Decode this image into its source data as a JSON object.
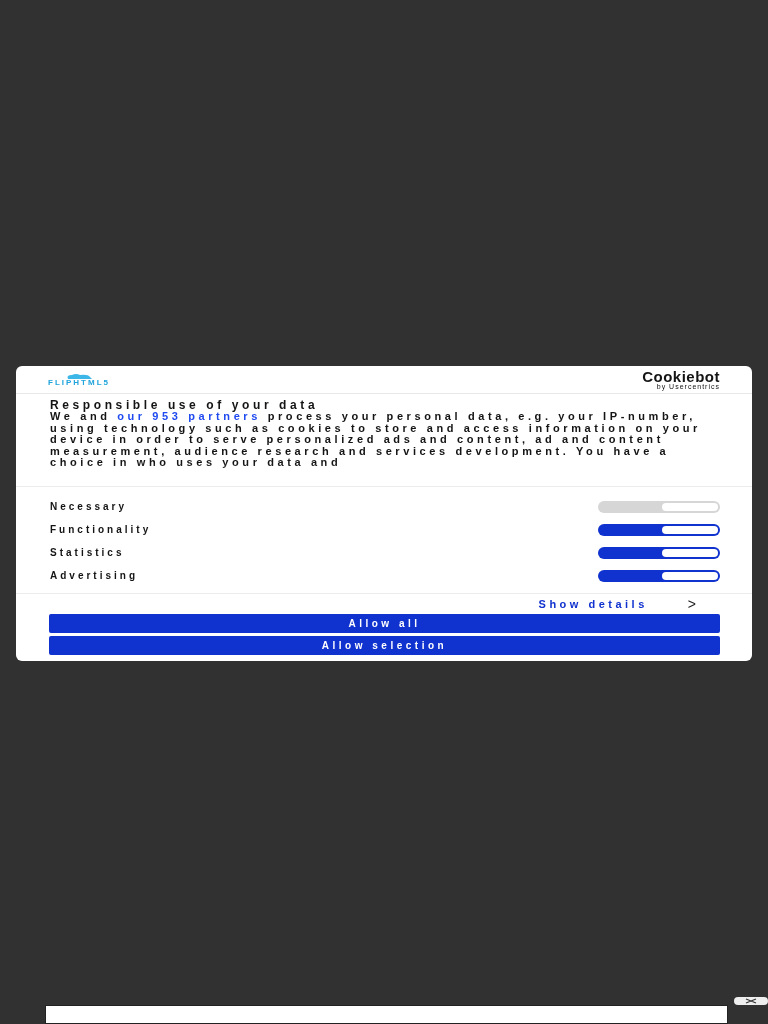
{
  "header": {
    "brand": "FLIPHTML5",
    "provider": "Cookiebot",
    "provider_sub": "by Usercentrics"
  },
  "consent": {
    "title": "Responsible use of your data",
    "text_before": "We and",
    "link": "our 953 partners",
    "text_after": "process your personal data, e.g. your IP-number, using technology such as cookies to store and access information on your device in order to serve personalized ads and content, ad and content measurement, audience research and services development. You have a choice in who uses your data and"
  },
  "categories": [
    {
      "label": "Necessary",
      "checked": true,
      "disabled": true
    },
    {
      "label": "Functionality",
      "checked": true,
      "disabled": false
    },
    {
      "label": "Statistics",
      "checked": true,
      "disabled": false
    },
    {
      "label": "Advertising",
      "checked": true,
      "disabled": false
    }
  ],
  "details": {
    "label": "Show details",
    "chevron": ">"
  },
  "buttons": [
    {
      "label": "Allow all"
    },
    {
      "label": "Allow selection"
    }
  ]
}
